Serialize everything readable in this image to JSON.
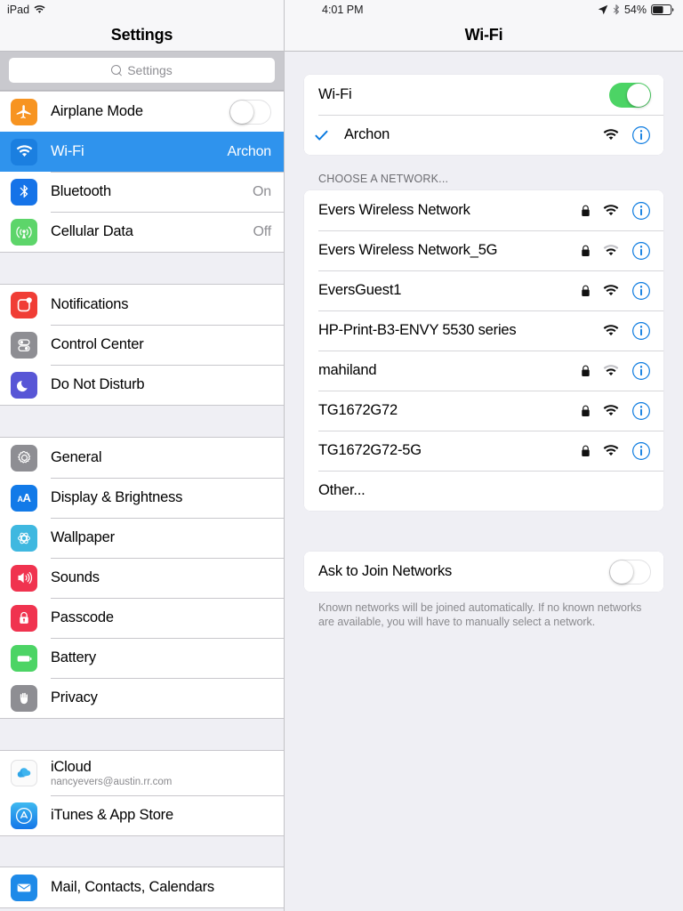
{
  "status_bar": {
    "device_label": "iPad",
    "wifi_icon": "wifi-icon",
    "time": "4:01 PM",
    "location_icon": "location-arrow-icon",
    "bluetooth_icon": "bluetooth-icon",
    "battery_percent": "54%",
    "battery_icon": "battery-icon"
  },
  "sidebar": {
    "title": "Settings",
    "search": {
      "placeholder": "Settings",
      "value": "",
      "icon": "search-icon"
    },
    "groups": [
      {
        "items": [
          {
            "label": "Airplane Mode",
            "icon": "airplane-icon",
            "control": "toggle",
            "toggle_on": false
          },
          {
            "label": "Wi-Fi",
            "icon": "wifi-icon",
            "value": "Archon",
            "selected": true
          },
          {
            "label": "Bluetooth",
            "icon": "bluetooth-icon",
            "value": "On"
          },
          {
            "label": "Cellular Data",
            "icon": "cellular-icon",
            "value": "Off"
          }
        ]
      },
      {
        "items": [
          {
            "label": "Notifications",
            "icon": "notifications-icon"
          },
          {
            "label": "Control Center",
            "icon": "control-center-icon"
          },
          {
            "label": "Do Not Disturb",
            "icon": "moon-icon"
          }
        ]
      },
      {
        "items": [
          {
            "label": "General",
            "icon": "gear-icon"
          },
          {
            "label": "Display & Brightness",
            "icon": "display-brightness-icon"
          },
          {
            "label": "Wallpaper",
            "icon": "wallpaper-icon"
          },
          {
            "label": "Sounds",
            "icon": "speaker-icon"
          },
          {
            "label": "Passcode",
            "icon": "lock-icon"
          },
          {
            "label": "Battery",
            "icon": "battery-icon"
          },
          {
            "label": "Privacy",
            "icon": "hand-icon"
          }
        ]
      },
      {
        "items": [
          {
            "label": "iCloud",
            "icon": "icloud-icon",
            "sublabel": "nancyevers@austin.rr.com"
          },
          {
            "label": "iTunes & App Store",
            "icon": "app-store-icon"
          }
        ]
      },
      {
        "items": [
          {
            "label": "Mail, Contacts, Calendars",
            "icon": "mail-icon"
          }
        ]
      }
    ]
  },
  "detail": {
    "title": "Wi-Fi",
    "wifi_toggle": {
      "label": "Wi-Fi",
      "on": true
    },
    "connected_network": {
      "name": "Archon",
      "checked": true,
      "secure": false,
      "signal": 3,
      "info_icon": "info-icon"
    },
    "section_header": "CHOOSE A NETWORK...",
    "networks": [
      {
        "name": "Evers Wireless Network",
        "secure": true,
        "signal": 3,
        "info_icon": "info-icon"
      },
      {
        "name": "Evers Wireless Network_5G",
        "secure": true,
        "signal": 2,
        "info_icon": "info-icon"
      },
      {
        "name": "EversGuest1",
        "secure": true,
        "signal": 3,
        "info_icon": "info-icon"
      },
      {
        "name": "HP-Print-B3-ENVY 5530 series",
        "secure": false,
        "signal": 3,
        "info_icon": "info-icon"
      },
      {
        "name": "mahiland",
        "secure": true,
        "signal": 2,
        "info_icon": "info-icon"
      },
      {
        "name": "TG1672G72",
        "secure": true,
        "signal": 3,
        "info_icon": "info-icon"
      },
      {
        "name": "TG1672G72-5G",
        "secure": true,
        "signal": 3,
        "info_icon": "info-icon"
      }
    ],
    "other_label": "Other...",
    "ask_to_join": {
      "label": "Ask to Join Networks",
      "on": false
    },
    "footnote": "Known networks will be joined automatically. If no known networks are available, you will have to manually select a network."
  },
  "colors": {
    "selection_blue": "#2f93ed",
    "toggle_green": "#4cd465",
    "info_blue": "#0a7ae0",
    "page_bg": "#efeff4"
  }
}
